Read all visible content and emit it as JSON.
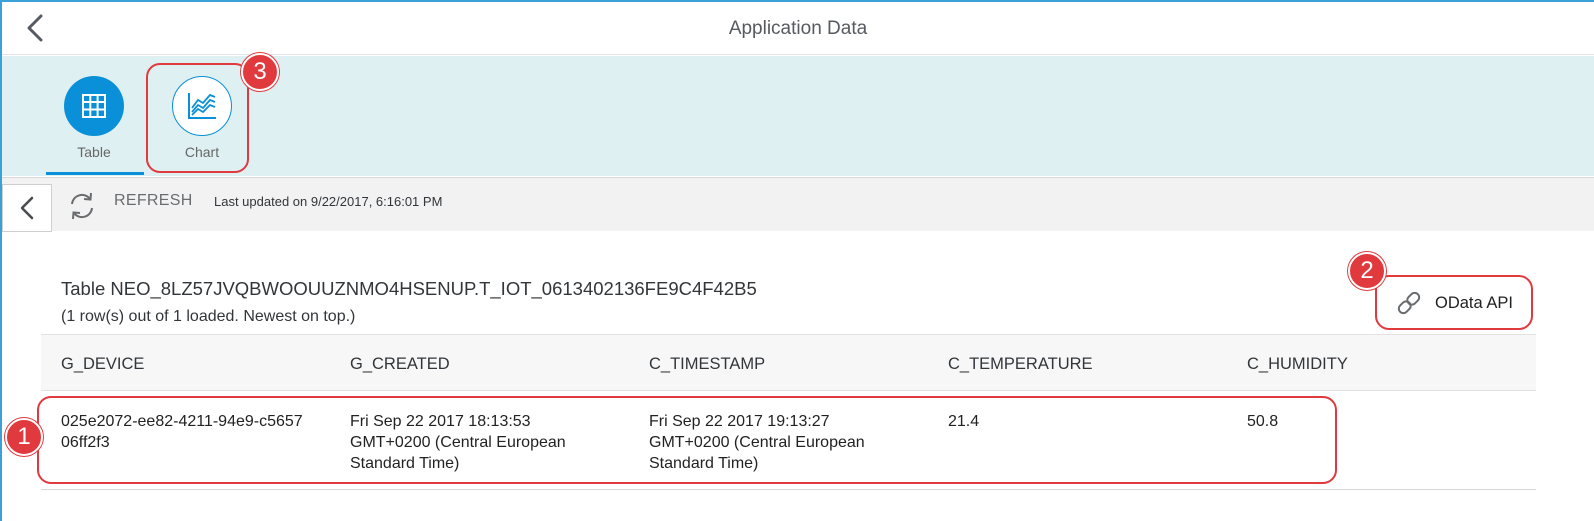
{
  "header": {
    "title": "Application Data"
  },
  "tabs": [
    {
      "label": "Table",
      "icon": "table-grid-icon",
      "selected": true
    },
    {
      "label": "Chart",
      "icon": "line-chart-icon",
      "selected": false
    }
  ],
  "toolbar": {
    "refresh_label": "REFRESH",
    "last_updated": "Last updated on 9/22/2017, 6:16:01 PM"
  },
  "content": {
    "table_title": "Table NEO_8LZ57JVQBWOOUUZNMO4HSENUP.T_IOT_0613402136FE9C4F42B5",
    "table_subtitle": "(1 row(s) out of 1 loaded. Newest on top.)",
    "odata_label": "OData API"
  },
  "table": {
    "columns": [
      "G_DEVICE",
      "G_CREATED",
      "C_TIMESTAMP",
      "C_TEMPERATURE",
      "C_HUMIDITY"
    ],
    "rows": [
      {
        "device_line1": "025e2072-ee82-4211-94e9-c5657",
        "device_line2": "06ff2f3",
        "created_line1": "Fri Sep 22 2017 18:13:53",
        "created_line2": "GMT+0200 (Central European",
        "created_line3": "Standard Time)",
        "timestamp_line1": "Fri Sep 22 2017 19:13:27",
        "timestamp_line2": "GMT+0200 (Central European",
        "timestamp_line3": "Standard Time)",
        "temperature": "21.4",
        "humidity": "50.8"
      }
    ]
  },
  "callouts": [
    "1",
    "2",
    "3"
  ],
  "colors": {
    "accent": "#0a90d8",
    "callout": "#e0393e",
    "tabbar_bg": "#dff0f3"
  }
}
